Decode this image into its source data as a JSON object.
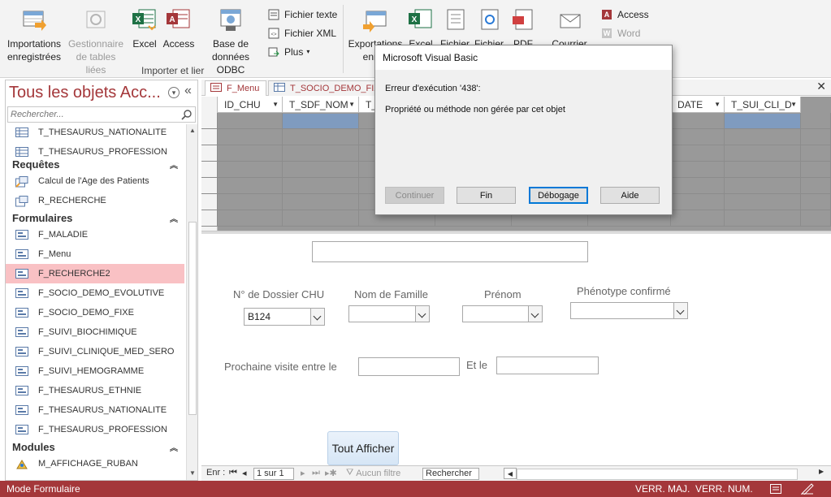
{
  "ribbon": {
    "btn_importations": "Importations\nenregistrées",
    "btn_importations_l1": "Importations",
    "btn_importations_l2": "enregistrées",
    "btn_gestionnaire_l1": "Gestionnaire",
    "btn_gestionnaire_l2": "de tables liées",
    "btn_excel": "Excel",
    "btn_access": "Access",
    "btn_odbc_l1": "Base de",
    "btn_odbc_l2": "données ODBC",
    "btn_fichier_texte": "Fichier texte",
    "btn_fichier_xml": "Fichier XML",
    "btn_plus": "Plus",
    "group_importer": "Importer et lier",
    "btn_exportations_l1": "Exportations",
    "btn_exportations_l2": "enreg",
    "btn_export_excel": "Excel",
    "btn_export_fichier1": "Fichier",
    "btn_export_fichier2": "Fichier",
    "btn_export_pdf": "PDF",
    "btn_courrier": "Courrier",
    "btn_export_access": "Access",
    "btn_export_word": "Word"
  },
  "nav": {
    "title": "Tous les objets Acc...",
    "search_placeholder": "Rechercher...",
    "items_top": [
      "T_THESAURUS_NATIONALITE",
      "T_THESAURUS_PROFESSION"
    ],
    "cat_requetes": "Requêtes",
    "requetes": [
      "Calcul de l'Age des Patients",
      "R_RECHERCHE"
    ],
    "cat_formulaires": "Formulaires",
    "formulaires": [
      "F_MALADIE",
      "F_Menu",
      "F_RECHERCHE2",
      "F_SOCIO_DEMO_EVOLUTIVE",
      "F_SOCIO_DEMO_FIXE",
      "F_SUIVI_BIOCHIMIQUE",
      "F_SUIVI_CLINIQUE_MED_SERO",
      "F_SUIVI_HEMOGRAMME",
      "F_THESAURUS_ETHNIE",
      "F_THESAURUS_NATIONALITE",
      "F_THESAURUS_PROFESSION"
    ],
    "selected": "F_RECHERCHE2",
    "cat_modules": "Modules",
    "modules": [
      "M_AFFICHAGE_RUBAN"
    ]
  },
  "tabs": [
    "F_Menu",
    "T_SOCIO_DEMO_FIXE"
  ],
  "sheet": {
    "columns": [
      "ID_CHU",
      "T_SDF_NOM",
      "T_S",
      "DATE",
      "T_SUI_CLI_D"
    ],
    "new_row_marker": "✱"
  },
  "form": {
    "label_dossier": "N° de Dossier CHU",
    "value_dossier": "B124",
    "label_nom": "Nom de Famille",
    "label_prenom": "Prénom",
    "label_phenotype": "Phénotype confirmé",
    "label_visite": "Prochaine visite entre le",
    "label_etle": "Et le",
    "btn_tout_afficher": "Tout Afficher"
  },
  "recnav": {
    "label": "Enr :",
    "position": "1 sur 1",
    "filter": "Aucun filtre",
    "search": "Rechercher"
  },
  "status": {
    "mode": "Mode Formulaire",
    "caps": "VERR. MAJ.",
    "num": "VERR. NUM."
  },
  "dialog": {
    "title": "Microsoft Visual Basic",
    "error": "Erreur d'exécution '438':",
    "message": "Propriété ou méthode non gérée par cet objet",
    "btn_continuer": "Continuer",
    "btn_fin": "Fin",
    "btn_debogage": "Débogage",
    "btn_aide": "Aide"
  },
  "colors": {
    "accent": "#a4373a",
    "selected_nav": "#f9c1c4",
    "excel_green": "#1e7145",
    "access_red": "#a4373a"
  }
}
